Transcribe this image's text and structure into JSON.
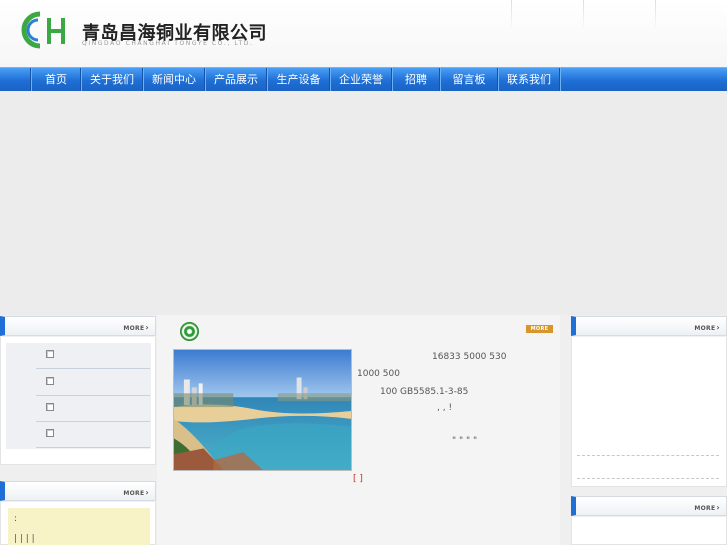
{
  "header": {
    "logo_mark": "CH",
    "company_name": "青岛昌海铜业有限公司",
    "company_name_en": "QINGDAO CHANGHAI TONGYE CO., LTD."
  },
  "nav": {
    "items": [
      "首页",
      "关于我们",
      "新闻中心",
      "产品展示",
      "生产设备",
      "企业荣誉",
      "招聘",
      "留言板",
      "联系我们"
    ]
  },
  "left_box_1": {
    "more": "MORE",
    "items": [
      "",
      "",
      "",
      ""
    ]
  },
  "left_box_2": {
    "more": "MORE",
    "line_1": ":",
    "line_2": "| | | |"
  },
  "center": {
    "more": "MORE",
    "text_lines": [
      "16833    5000      530",
      "1000                                500",
      "100                         GB5585.1-3-85",
      ",          ,            !",
      "\"              \"        \"        \""
    ],
    "bracket": "[   ]"
  },
  "right_box_1": {
    "more": "MORE"
  },
  "right_box_2": {
    "more": "MORE"
  },
  "colors": {
    "nav_blue": "#1f6fd6",
    "logo_green": "#3aa843",
    "more_orange": "#d8962a"
  }
}
